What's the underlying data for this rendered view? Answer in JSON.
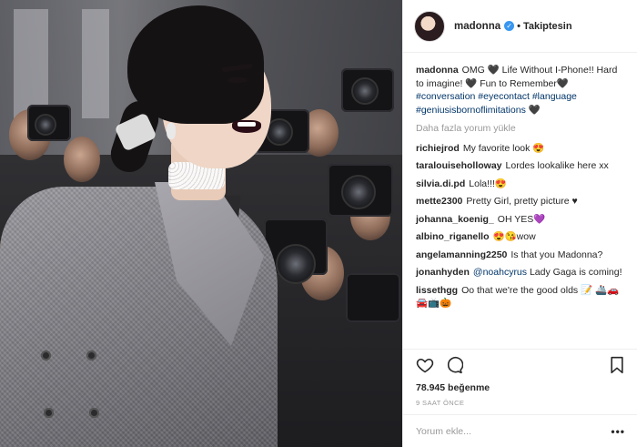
{
  "post": {
    "author": "madonna",
    "verified_icon": "verified-badge-icon",
    "follow_label": "Takiptesin",
    "caption": {
      "text_1": "OMG 🖤 Life Without I-Phone!! Hard to imagine! 🖤 Fun to Remember🖤",
      "hashtags": [
        "#conversation",
        "#eyecontact",
        "#language",
        "#geniusisbornoflimitations"
      ],
      "tail": "🖤"
    },
    "load_more": "Daha fazla yorum yükle",
    "comments": [
      {
        "user": "richiejrod",
        "text": "My favorite look 😍"
      },
      {
        "user": "taralouiseholloway",
        "text": "Lordes lookalike here xx"
      },
      {
        "user": "silvia.di.pd",
        "text": "Lola!!!😍"
      },
      {
        "user": "mette2300",
        "text": "Pretty Girl, pretty picture ♥"
      },
      {
        "user": "johanna_koenig_",
        "text": "OH YES💜"
      },
      {
        "user": "albino_riganello",
        "text": "😍😘wow"
      },
      {
        "user": "angelamanning2250",
        "text": "Is that you Madonna?"
      },
      {
        "user": "jonanhyden",
        "mention": "@noahcyrus",
        "text": "Lady Gaga is coming!"
      },
      {
        "user": "lissethgg",
        "text": "Oo that we're the good olds 📝 🚢🚗🚘📺🎃"
      }
    ],
    "likes": "78.945 beğenme",
    "time": "9 SAAT ÖNCE",
    "comment_placeholder": "Yorum ekle...",
    "more_icon": "ellipsis-icon",
    "icons": [
      "heart-icon",
      "comment-icon",
      "bookmark-icon"
    ]
  }
}
